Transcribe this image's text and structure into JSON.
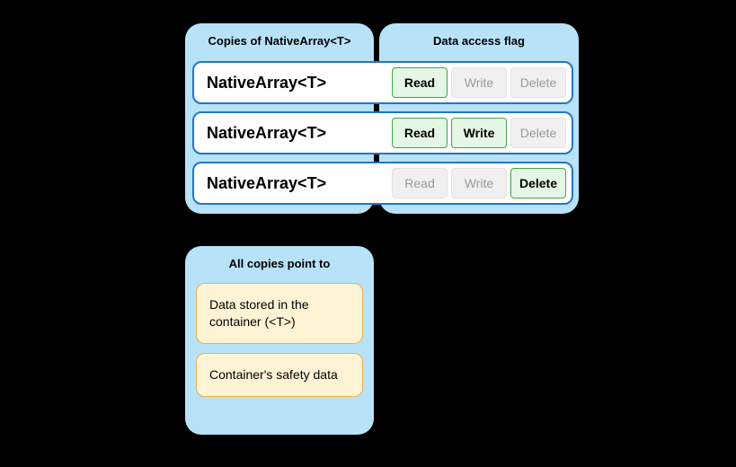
{
  "panels": {
    "copies": {
      "title": "Copies of NativeArray<T>"
    },
    "flags": {
      "title": "Data access flag"
    },
    "point": {
      "title": "All copies point to"
    }
  },
  "rows": [
    {
      "label": "NativeArray<T>",
      "flags": {
        "read": "Read",
        "write": "Write",
        "delete": "Delete"
      },
      "active": {
        "read": true,
        "write": false,
        "delete": false
      }
    },
    {
      "label": "NativeArray<T>",
      "flags": {
        "read": "Read",
        "write": "Write",
        "delete": "Delete"
      },
      "active": {
        "read": true,
        "write": true,
        "delete": false
      }
    },
    {
      "label": "NativeArray<T>",
      "flags": {
        "read": "Read",
        "write": "Write",
        "delete": "Delete"
      },
      "active": {
        "read": false,
        "write": false,
        "delete": true
      }
    }
  ],
  "targets": [
    "Data stored in the container (<T>)",
    "Container's safety data"
  ]
}
